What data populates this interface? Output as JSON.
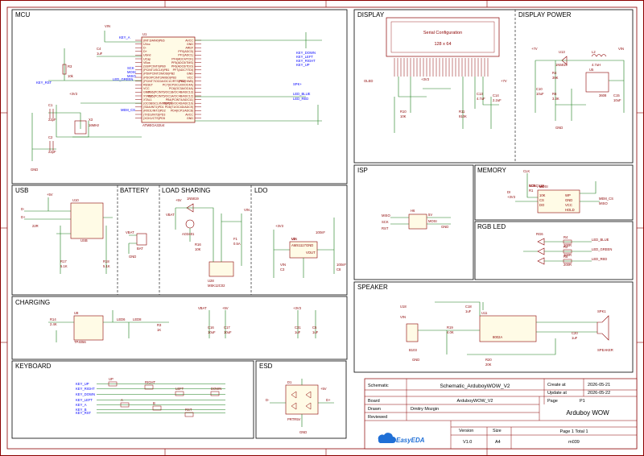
{
  "sections": {
    "mcu": "MCU",
    "display": "DISPLAY",
    "display_power": "DISPLAY POWER",
    "usb": "USB",
    "battery": "BATTERY",
    "load_sharing": "LOAD SHARING",
    "ldo": "LDO",
    "charging": "CHARGING",
    "isp": "ISP",
    "memory": "MEMORY",
    "rgb_led": "RGB LED",
    "speaker": "SPEAKER",
    "keyboard": "KEYBOARD",
    "esd": "ESD"
  },
  "mcu": {
    "chip_ref": "U1",
    "chip_name": "ATMEGA32U4",
    "left_pins": [
      "(INT.6/AIN0)PE6",
      "UVcc",
      "D-",
      "D+",
      "UGnd",
      "UCap",
      "VBus",
      "(SS/PCINT0)PB0",
      "(PCINT1/SCLK)PB1",
      "(PDI/PCINT2/MOSI)PB2",
      "(PDO/PCINT3/MISO)PB3",
      "(PCINT7/OC0A/OC1C/RTS)PB7",
      "RESET",
      "VCC",
      "GND",
      "XTAL2",
      "XTAL1",
      "(OC0B/SCL/INT0)PD0",
      "(SDA/INT1)PD1",
      "(RXD1/INT2)PD2",
      "(TXD1/INT3)PD3",
      "(XCK1/CTS)PD5"
    ],
    "right_pins": [
      "AVCC",
      "GND",
      "AREF",
      "PF0(ADC0)",
      "PF1(ADC1)",
      "PF4(ADC4/TCK)",
      "PF5(ADC5/TMS)",
      "PF6(ADC6/TDO)",
      "PF7(ADC7/TDI)",
      "GND",
      "VCC",
      "PE2(HWB)",
      "PC7(ICP3/CLK0/OC4A)",
      "PC6(OC3A/OC4A)",
      "PB6(PCINT6/OC1B/OC4B/ADC13)",
      "PB5(PCINT5/OC1A/OC4B/ADC12)",
      "PB4(PCINT4/ADC11)",
      "PD7(T0/OC4D/ADC10)",
      "PD6(T1/OC4D/ADC9)",
      "PD4(ICP1/ADC8)",
      "AVCC",
      "GND"
    ],
    "nets_left": [
      "KEY_A",
      "KEY_RST",
      "SCK",
      "MOSI",
      "MISO",
      "LED_GREEN",
      "MEM_CS"
    ],
    "nets_right": [
      "KEY_DOWN",
      "KEY_LEFT",
      "KEY_RIGHT",
      "KEY_UP",
      "SPK+",
      "LED_BLUE",
      "LED_RED"
    ],
    "parts": [
      "R3",
      "10k",
      "C1",
      "22pF",
      "C2",
      "22pF",
      "X3",
      "16MHz",
      "C4",
      "1uF",
      "+3V3",
      "VIN",
      "GND"
    ]
  },
  "display": {
    "box_line1": "Serial Configuration",
    "box_line2": "128 x 64",
    "ref": "OLED",
    "parts": [
      "C13",
      "4.7uF",
      "C14",
      "2.2uF",
      "R11",
      "910K",
      "R10",
      "10K",
      "+3V3",
      "+7V"
    ]
  },
  "display_power": {
    "parts": [
      "U13",
      "1N5819",
      "L2",
      "4.7uH",
      "R4",
      "39K",
      "R6",
      "3.3K",
      "C10",
      "10uF",
      "C15",
      "10uF",
      "U5",
      "3608",
      "+7V",
      "VIN",
      "GND"
    ]
  },
  "usb": {
    "parts": [
      "U10",
      "USB",
      "R17",
      "5.1K",
      "R18",
      "5.1K",
      "D-",
      "D+",
      "+5V",
      "22R"
    ]
  },
  "battery": {
    "parts": [
      "VBAT",
      "GND",
      "BAT"
    ]
  },
  "load_sharing": {
    "parts": [
      "1N5819",
      "AO3401",
      "R16",
      "10K",
      "F1",
      "0.5A",
      "U28",
      "MSK12C02",
      "VBAT",
      "+5V",
      "VIN"
    ]
  },
  "ldo": {
    "parts": [
      "U2",
      "AMS1117",
      "GND",
      "VOUT",
      "VIN",
      "C3",
      "100nF",
      "C8",
      "100nF",
      "+3V3",
      "VIN"
    ]
  },
  "charging": {
    "parts": [
      "U8",
      "TP4056",
      "R14",
      "2.4K",
      "LED6",
      "LED8",
      "R3",
      "1K",
      "C16",
      "10uF",
      "C17",
      "10uF",
      "C31",
      "1uF",
      "C5",
      "1uF",
      "VBAT",
      "+5V",
      "+3V3"
    ]
  },
  "isp": {
    "parts": [
      "H6",
      "MISO",
      "SCK",
      "RST",
      "5V",
      "MOSI",
      "GND"
    ]
  },
  "memory": {
    "parts": [
      "U4",
      "W25Q128",
      "R1",
      "10K",
      "CS",
      "DO",
      "WP",
      "GND",
      "VCC",
      "HOLD",
      "CLK",
      "DI",
      "+3V3",
      "MEM_CS",
      "MISO",
      "MOSI",
      "SCK"
    ]
  },
  "rgb_led": {
    "parts": [
      "RG6",
      "R4",
      "200R",
      "R2",
      "200R",
      "R5",
      "200R",
      "LED_BLUE",
      "LED_GREEN",
      "LED_RED"
    ]
  },
  "speaker": {
    "parts": [
      "U18",
      "U11",
      "8002A",
      "R19",
      "4.0K",
      "C18",
      "1uF",
      "C20",
      "1uF",
      "R20",
      "20K",
      "SPK1",
      "SPEAKER",
      "B103",
      "VIN",
      "GND"
    ]
  },
  "keyboard": {
    "nets": [
      "KEY_UP",
      "KEY_RIGHT",
      "KEY_DOWN",
      "KEY_LEFT",
      "KEY_A",
      "KEY_B",
      "KEY_RST"
    ],
    "buttons": [
      "UP",
      "RIGHT",
      "LEFT",
      "DOWN",
      "A",
      "B",
      "RST"
    ]
  },
  "esd": {
    "parts": [
      "D1",
      "PRTR5V",
      "D-",
      "D+",
      "+5V",
      "GND"
    ]
  },
  "title_block": {
    "schematic_label": "Schematic",
    "schematic_name": "Schematic_ArduboyWOW_V2",
    "created_label": "Create at",
    "created_date": "2026-05-21",
    "updated_label": "Update at",
    "updated_date": "2026-05-22",
    "board_label": "Board",
    "board_name": "ArduboyWOW_V2",
    "page_label": "Page",
    "page_value": "P1",
    "drawn_label": "Drawn",
    "drawn_by": "Dmitry Mozgin",
    "reviewed_label": "Reviewed",
    "reviewed_by": "",
    "project_name": "Arduboy WOW",
    "version_label": "Version",
    "size_label": "Size",
    "version": "V1.0",
    "size": "A4",
    "page_total": "Page 1   Total 1",
    "doc_number": "m039",
    "logo_text": "EasyEDA"
  },
  "colors": {
    "frame": "#8b0000",
    "wire": "#1a7f1a",
    "net": "#0000ff",
    "part": "#8b0000",
    "section_line": "#000000"
  }
}
